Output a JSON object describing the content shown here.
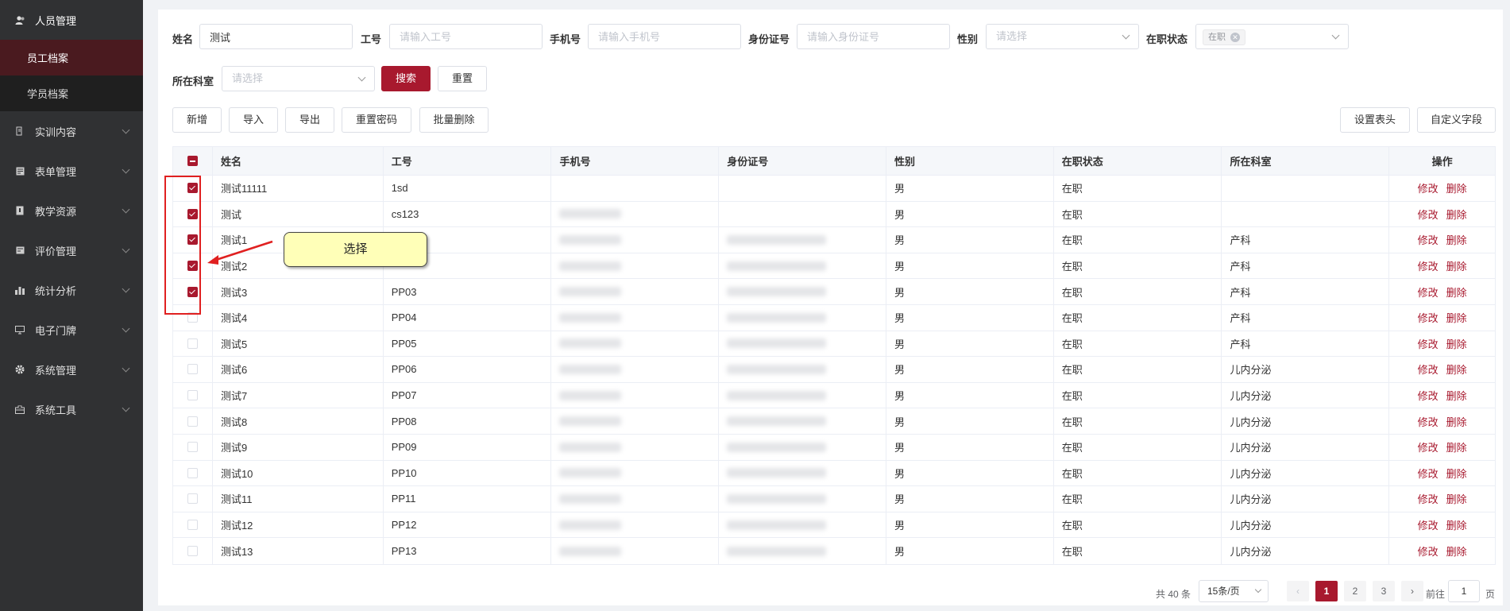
{
  "sidebar": {
    "items": [
      {
        "label": "人员管理",
        "icon": "users-icon",
        "expanded": true,
        "children": [
          {
            "label": "员工档案",
            "active": true
          },
          {
            "label": "学员档案",
            "active": false
          }
        ]
      },
      {
        "label": "实训内容",
        "icon": "training-icon"
      },
      {
        "label": "表单管理",
        "icon": "form-icon"
      },
      {
        "label": "教学资源",
        "icon": "book-icon"
      },
      {
        "label": "评价管理",
        "icon": "evaluation-icon"
      },
      {
        "label": "统计分析",
        "icon": "chart-icon"
      },
      {
        "label": "电子门牌",
        "icon": "monitor-icon"
      },
      {
        "label": "系统管理",
        "icon": "gear-icon"
      },
      {
        "label": "系统工具",
        "icon": "toolbox-icon"
      }
    ]
  },
  "filters": {
    "name_label": "姓名",
    "name_value": "测试",
    "jobno_label": "工号",
    "jobno_placeholder": "请输入工号",
    "phone_label": "手机号",
    "phone_placeholder": "请输入手机号",
    "idcard_label": "身份证号",
    "idcard_placeholder": "请输入身份证号",
    "gender_label": "性别",
    "gender_placeholder": "请选择",
    "status_label": "在职状态",
    "status_tag": "在职",
    "dept_label": "所在科室",
    "dept_placeholder": "请选择",
    "search_btn": "搜索",
    "reset_btn": "重置"
  },
  "toolbar": {
    "add": "新增",
    "import": "导入",
    "export": "导出",
    "reset_pwd": "重置密码",
    "batch_delete": "批量删除",
    "set_header": "设置表头",
    "custom_field": "自定义字段"
  },
  "table": {
    "headers": [
      "姓名",
      "工号",
      "手机号",
      "身份证号",
      "性别",
      "在职状态",
      "所在科室",
      "操作"
    ],
    "edit_label": "修改",
    "delete_label": "删除",
    "rows": [
      {
        "checked": true,
        "name": "测试11111",
        "jobno": "1sd",
        "phone": false,
        "idcard": false,
        "gender": "男",
        "status": "在职",
        "dept": ""
      },
      {
        "checked": true,
        "name": "测试",
        "jobno": "cs123",
        "phone": true,
        "idcard": false,
        "gender": "男",
        "status": "在职",
        "dept": ""
      },
      {
        "checked": true,
        "name": "测试1",
        "jobno": "",
        "phone": true,
        "idcard": true,
        "gender": "男",
        "status": "在职",
        "dept": "产科"
      },
      {
        "checked": true,
        "name": "测试2",
        "jobno": "",
        "phone": true,
        "idcard": true,
        "gender": "男",
        "status": "在职",
        "dept": "产科"
      },
      {
        "checked": true,
        "name": "测试3",
        "jobno": "PP03",
        "phone": true,
        "idcard": true,
        "gender": "男",
        "status": "在职",
        "dept": "产科"
      },
      {
        "checked": false,
        "name": "测试4",
        "jobno": "PP04",
        "phone": true,
        "idcard": true,
        "gender": "男",
        "status": "在职",
        "dept": "产科"
      },
      {
        "checked": false,
        "name": "测试5",
        "jobno": "PP05",
        "phone": true,
        "idcard": true,
        "gender": "男",
        "status": "在职",
        "dept": "产科"
      },
      {
        "checked": false,
        "name": "测试6",
        "jobno": "PP06",
        "phone": true,
        "idcard": true,
        "gender": "男",
        "status": "在职",
        "dept": "儿内分泌"
      },
      {
        "checked": false,
        "name": "测试7",
        "jobno": "PP07",
        "phone": true,
        "idcard": true,
        "gender": "男",
        "status": "在职",
        "dept": "儿内分泌"
      },
      {
        "checked": false,
        "name": "测试8",
        "jobno": "PP08",
        "phone": true,
        "idcard": true,
        "gender": "男",
        "status": "在职",
        "dept": "儿内分泌"
      },
      {
        "checked": false,
        "name": "测试9",
        "jobno": "PP09",
        "phone": true,
        "idcard": true,
        "gender": "男",
        "status": "在职",
        "dept": "儿内分泌"
      },
      {
        "checked": false,
        "name": "测试10",
        "jobno": "PP10",
        "phone": true,
        "idcard": true,
        "gender": "男",
        "status": "在职",
        "dept": "儿内分泌"
      },
      {
        "checked": false,
        "name": "测试11",
        "jobno": "PP11",
        "phone": true,
        "idcard": true,
        "gender": "男",
        "status": "在职",
        "dept": "儿内分泌"
      },
      {
        "checked": false,
        "name": "测试12",
        "jobno": "PP12",
        "phone": true,
        "idcard": true,
        "gender": "男",
        "status": "在职",
        "dept": "儿内分泌"
      },
      {
        "checked": false,
        "name": "测试13",
        "jobno": "PP13",
        "phone": true,
        "idcard": true,
        "gender": "男",
        "status": "在职",
        "dept": "儿内分泌"
      }
    ]
  },
  "pagination": {
    "total": "共 40 条",
    "page_size": "15条/页",
    "pages": [
      "1",
      "2",
      "3"
    ],
    "current": "1",
    "goto_label": "前往",
    "goto_value": "1",
    "goto_suffix": "页"
  },
  "annotation": {
    "callout_text": "选择"
  },
  "colors": {
    "accent": "#a8192e",
    "sidebar_bg": "#303133",
    "annotation_red": "#e02020",
    "callout_bg": "#ffffb8"
  }
}
